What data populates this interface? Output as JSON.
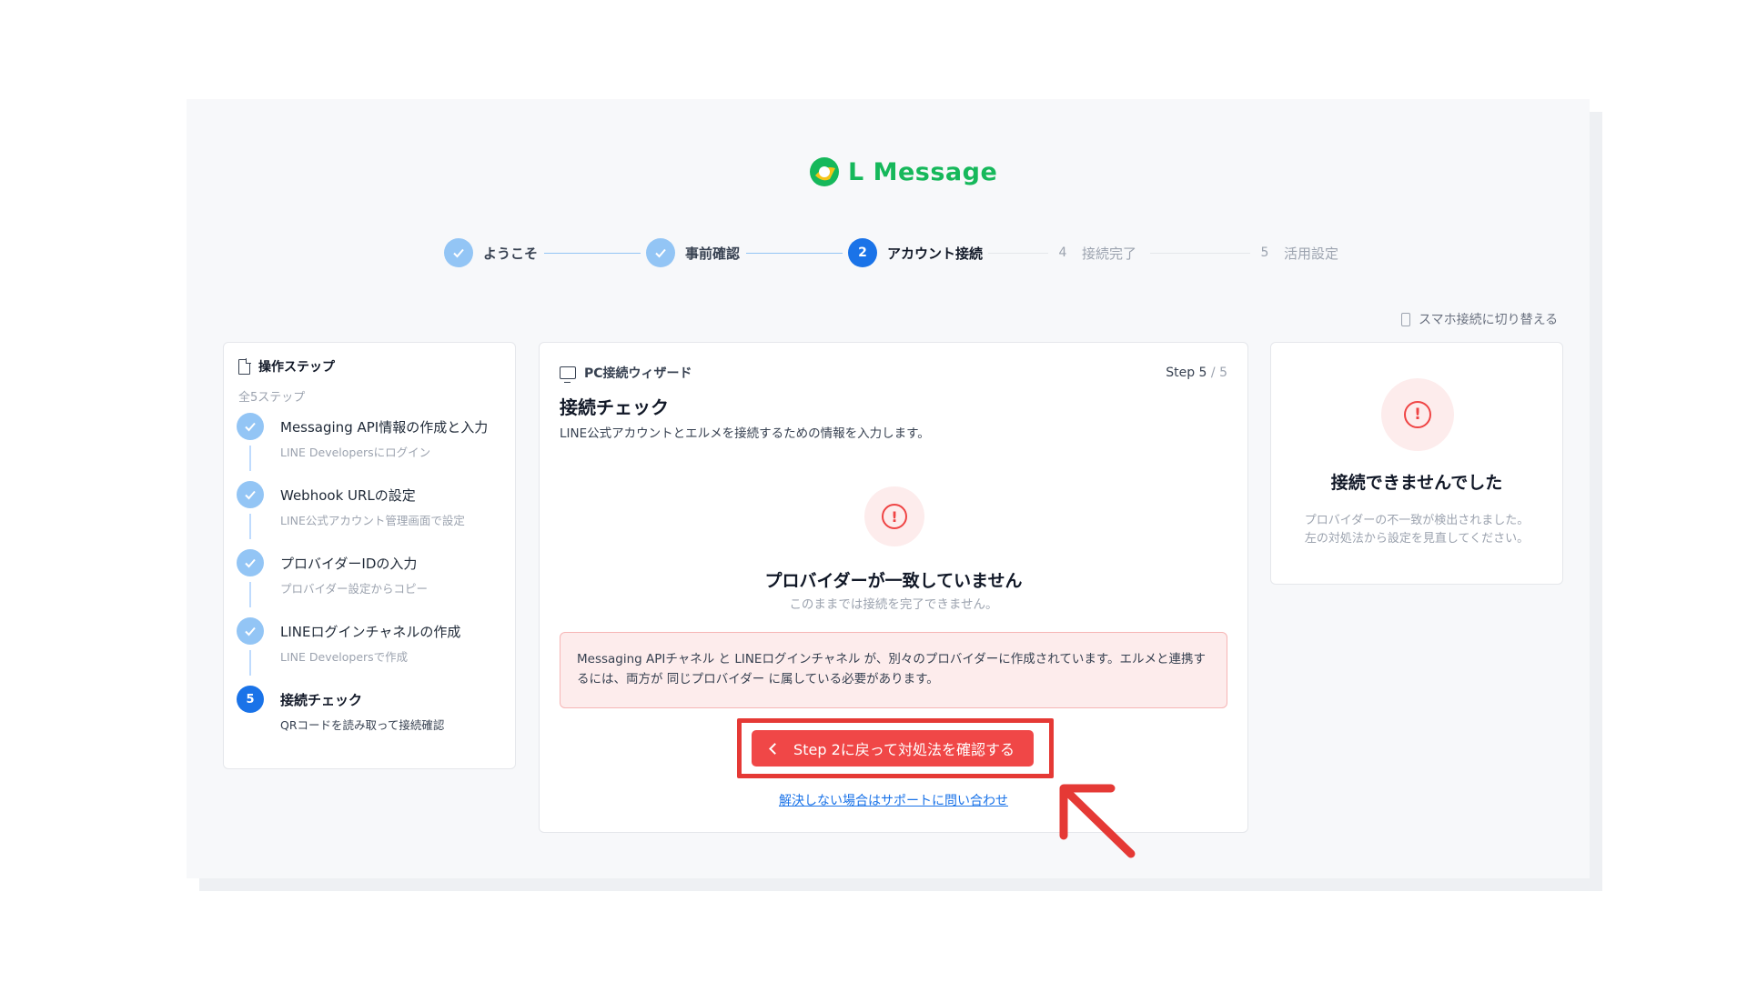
{
  "app": {
    "brand": "L Message",
    "brand_color": "#16b85b",
    "accent_color": "#1a73e8",
    "error_color": "#ef4444"
  },
  "stepper": {
    "steps": [
      {
        "index": "1",
        "label": "ようこそ",
        "state": "done"
      },
      {
        "index": "2",
        "label": "事前確認",
        "state": "done"
      },
      {
        "index": "2",
        "label": "アカウント接続",
        "state": "active"
      },
      {
        "index": "4",
        "label": "接続完了",
        "state": "todo"
      },
      {
        "index": "5",
        "label": "活用設定",
        "state": "todo"
      }
    ]
  },
  "switch_link": {
    "label": "スマホ接続に切り替える",
    "icon": "smartphone-icon"
  },
  "sidebar": {
    "title": "操作ステップ",
    "subtitle": "全5ステップ",
    "items": [
      {
        "number": "1",
        "label": "Messaging API情報の作成と入力",
        "desc": "LINE Developersにログイン",
        "state": "done"
      },
      {
        "number": "2",
        "label": "Webhook URLの設定",
        "desc": "LINE公式アカウント管理画面で設定",
        "state": "done"
      },
      {
        "number": "3",
        "label": "プロバイダーIDの入力",
        "desc": "プロバイダー設定からコピー",
        "state": "done"
      },
      {
        "number": "4",
        "label": "LINEログインチャネルの作成",
        "desc": "LINE Developersで作成",
        "state": "done"
      },
      {
        "number": "5",
        "label": "接続チェック",
        "desc": "QRコードを読み取って接続確認",
        "state": "active"
      }
    ]
  },
  "main": {
    "header": "PC接続ウィザード",
    "step_prefix": "Step 5",
    "step_total": " / 5",
    "title": "接続チェック",
    "description": "LINE公式アカウントとエルメを接続するための情報を入力します。",
    "error_title": "プロバイダーが一致していません",
    "error_subtitle": "このままでは接続を完了できません。",
    "error_detail": "Messaging APIチャネル と LINEログインチャネル が、別々のプロバイダーに作成されています。エルメと連携するには、両方が 同じプロバイダー に属している必要があります。",
    "back_button": "Step 2に戻って対処法を確認する",
    "support_link": "解決しない場合はサポートに問い合わせ"
  },
  "status_panel": {
    "title": "接続できませんでした",
    "line1": "プロバイダーの不一致が検出されました。",
    "line2": "左の対処法から設定を見直してください。"
  }
}
